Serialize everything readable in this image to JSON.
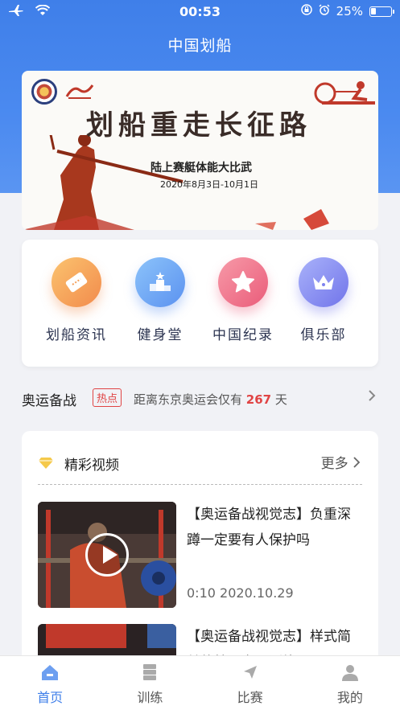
{
  "status_bar": {
    "time": "00:53",
    "battery": "25%",
    "battery_level": 0.25
  },
  "app": {
    "title": "中国划船"
  },
  "banner": {
    "title": "划船重走长征路",
    "subtitle": "陆上赛艇体能大比武",
    "date": "2020年8月3日-10月1日"
  },
  "menu": [
    {
      "label": "划船资讯",
      "icon": "ticket-icon",
      "color": "#f7a35c"
    },
    {
      "label": "健身堂",
      "icon": "podium-icon",
      "color": "#6ea8f5"
    },
    {
      "label": "中国纪录",
      "icon": "star-icon",
      "color": "#f0718a"
    },
    {
      "label": "俱乐部",
      "icon": "crown-icon",
      "color": "#8a8ff0"
    }
  ],
  "olympic": {
    "title": "奥运备战",
    "badge": "热点",
    "text_prefix": "距离东京奥运会仅有",
    "days": "267",
    "text_suffix": "天"
  },
  "videos_section": {
    "title": "精彩视频",
    "more": "更多",
    "items": [
      {
        "title": "【奥运备战视觉志】负重深蹲一定要有人保护吗",
        "duration": "0:10",
        "date": "2020.10.29"
      },
      {
        "title": "【奥运备战视觉志】样式简单的核心力量训练",
        "duration": "",
        "date": ""
      }
    ]
  },
  "tabs": [
    {
      "label": "首页",
      "icon": "home-icon",
      "active": true
    },
    {
      "label": "训练",
      "icon": "training-icon",
      "active": false
    },
    {
      "label": "比赛",
      "icon": "competition-icon",
      "active": false
    },
    {
      "label": "我的",
      "icon": "profile-icon",
      "active": false
    }
  ],
  "colors": {
    "primary": "#3f7fe9",
    "hot": "#e04444"
  }
}
